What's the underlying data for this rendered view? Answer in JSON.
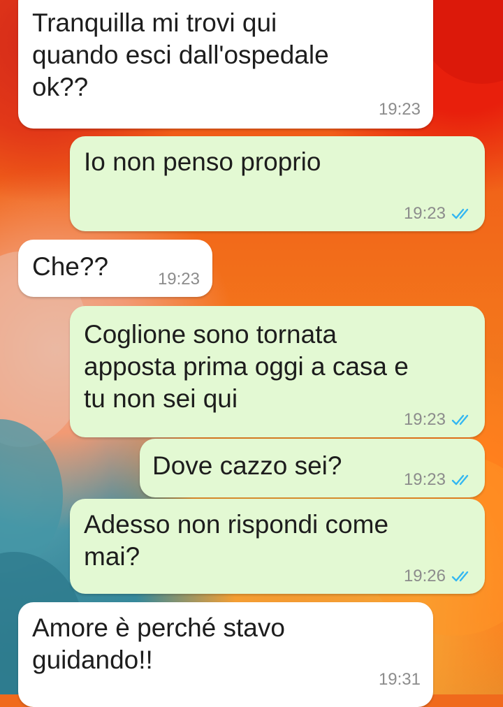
{
  "conversation": {
    "messages": [
      {
        "id": "m1",
        "direction": "incoming",
        "text": "Tranquilla mi trovi qui\nquando esci dall'ospedale\nok??",
        "time": "19:23"
      },
      {
        "id": "m2",
        "direction": "outgoing",
        "text": "Io non penso proprio",
        "time": "19:23",
        "status": "read"
      },
      {
        "id": "m3",
        "direction": "incoming",
        "text": "Che??",
        "time": "19:23"
      },
      {
        "id": "m4",
        "direction": "outgoing",
        "text": "Coglione sono tornata\napposta prima oggi a casa e\ntu non sei qui",
        "time": "19:23",
        "status": "read"
      },
      {
        "id": "m5",
        "direction": "outgoing",
        "text": "Dove cazzo sei?",
        "time": "19:23",
        "status": "read"
      },
      {
        "id": "m6",
        "direction": "outgoing",
        "text": "Adesso non rispondi come\nmai?",
        "time": "19:26",
        "status": "read"
      },
      {
        "id": "m7",
        "direction": "incoming",
        "text": "Amore è perché stavo\nguidando!!",
        "time": "19:31"
      }
    ],
    "colors": {
      "incoming_bubble": "#ffffff",
      "outgoing_bubble": "#e3f9d3",
      "read_ticks": "#34b7f1",
      "timestamp": "#8c8c8c"
    },
    "icons": {
      "read_status": "double-check-icon"
    }
  }
}
